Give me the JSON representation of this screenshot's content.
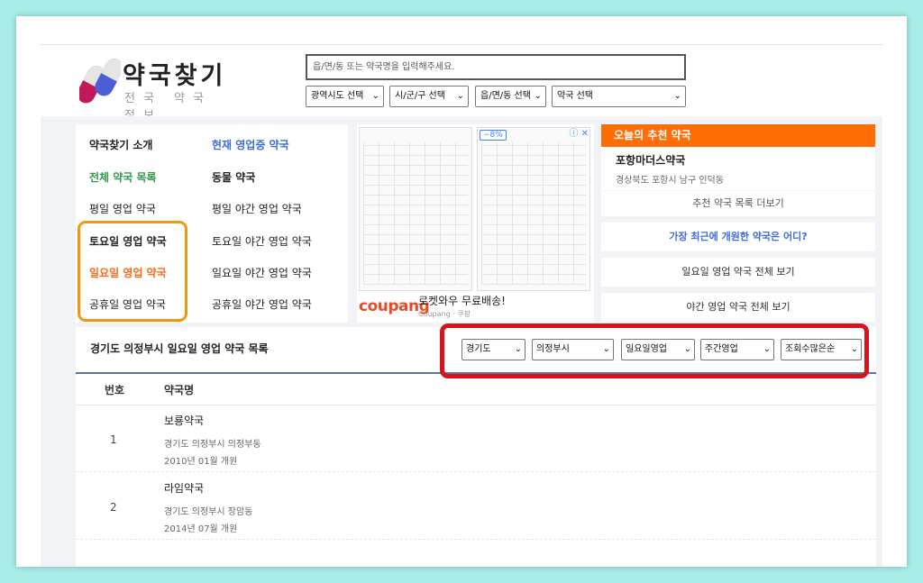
{
  "site": {
    "title": "약국찾기",
    "subtitle": "전국 약국 정보"
  },
  "search": {
    "placeholder": "읍/면/동 또는 약국명을 입력해주세요."
  },
  "top_filters": [
    "광역시도 선택",
    "시/군/구 선택",
    "읍/면/동 선택",
    "약국 선택"
  ],
  "menu": {
    "left": [
      "약국찾기 소개",
      "전체 약국 목록",
      "평일 영업 약국",
      "토요일 영업 약국",
      "일요일 영업 약국",
      "공휴일 영업 약국"
    ],
    "right": [
      "현재 영업중 약국",
      "동물 약국",
      "평일 야간 영업 약국",
      "토요일 야간 영업 약국",
      "일요일 야간 영업 약국",
      "공휴일 야간 영업 약국"
    ]
  },
  "ad": {
    "brand": "coupang",
    "text": "로켓와우 무료배송!",
    "source": "Coupang · 쿠팡",
    "badge": "~8%",
    "icons": "ⓘ ✕"
  },
  "recommend": {
    "header": "오늘의 추천 약국",
    "name": "포항마더스약국",
    "address": "경상북도 포항시 남구 인덕동",
    "more": "추천 약국 목록 더보기",
    "newest": "가장 최근에 개원한 약국은 어디?",
    "sunday_all": "일요일 영업 약국 전체 보기",
    "night_all": "야간 영업 약국 전체 보기"
  },
  "list": {
    "title": "경기도 의정부시 일요일 영업 약국 목록",
    "filters": [
      "경기도",
      "의정부시",
      "일요일영업",
      "주간영업",
      "조회수많은순"
    ],
    "headers": {
      "num": "번호",
      "name": "약국명"
    },
    "rows": [
      {
        "num": "1",
        "name": "보룡약국",
        "address": "경기도 의정부시 의정부동",
        "opened": "2010년 01월 개원"
      },
      {
        "num": "2",
        "name": "라임약국",
        "address": "경기도 의정부시 장암동",
        "opened": "2014년 07월 개원"
      }
    ]
  },
  "colors": {
    "recommend_header": "#ff6d06",
    "highlight_orange": "#f0960f",
    "highlight_red": "#d7141b",
    "link_blue": "#3f6dd6",
    "link_green": "#2f9a49"
  }
}
